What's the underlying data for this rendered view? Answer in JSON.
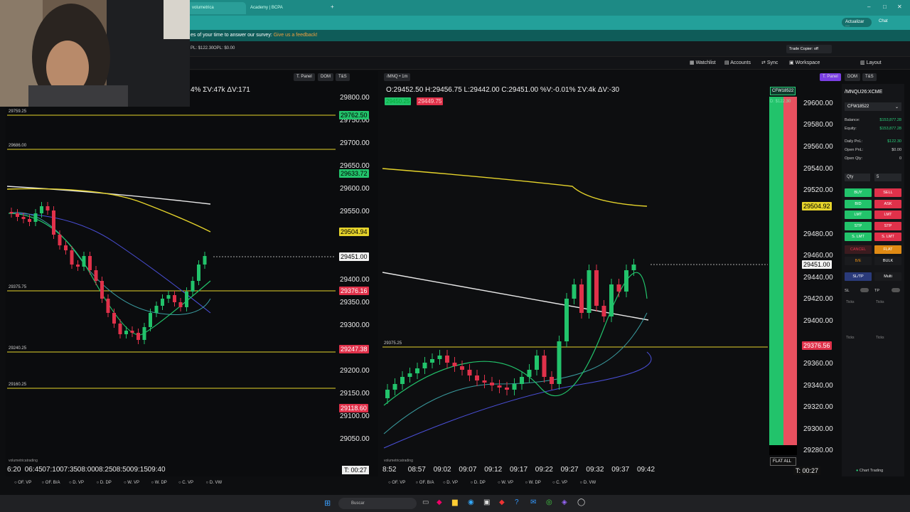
{
  "browser": {
    "tabs": [
      {
        "label": "volumetrica"
      },
      {
        "label": "Academy | BCPA"
      }
    ],
    "account_btn": "Actualizar",
    "chat_btn": "Chat"
  },
  "survey": {
    "text": "es of your time to answer our survey:",
    "link": "Give us a feedback!"
  },
  "appbar": {
    "upl": "PL: $122.30",
    "opl": "OPL: $0.00",
    "trade_copier": "Trade Copier: off"
  },
  "toolbar": {
    "watchlist": "Watchlist",
    "accounts": "Accounts",
    "sync": "Sync",
    "workspace": "Workspace",
    "layout": "Layout"
  },
  "left_chart": {
    "header_buttons": {
      "tpanel": "T. Panel",
      "dom": "DOM",
      "ts": "T&S"
    },
    "ohlc": "4% ΣV:47k ΔV:171",
    "price_axis": [
      "29800.00",
      "29750.00",
      "29700.00",
      "29650.00",
      "29600.00",
      "29550.00",
      "29450.00",
      "29400.00",
      "29350.00",
      "29300.00",
      "29200.00",
      "29150.00",
      "29100.00",
      "29050.00"
    ],
    "tags": {
      "t1": "29762.50",
      "t2": "29633.72",
      "t3": "29504.94",
      "t4": "29451.00",
      "t5": "29376.16",
      "t6": "29247.38",
      "t7": "29118.60"
    },
    "levels": [
      "29759.25",
      "29686.00",
      "29375.75",
      "29240.25",
      "29160.25"
    ],
    "time_axis": [
      "6:20",
      "06:45",
      "07:10",
      "07:35",
      "08:00",
      "08:25",
      "08:50",
      "09:15",
      "09:40"
    ],
    "timer": "T: 00:27",
    "watermark": "volumetricatrading"
  },
  "right_chart": {
    "symbol": "/MNQ",
    "timeframe": "1m",
    "header_buttons": {
      "tpanel": "T. Panel",
      "dom": "DOM",
      "ts": "T&S"
    },
    "ohlc": "O:29452.50  H:29456.75  L:29442.00  C:29451.00  %V:-0.01%  ΣV:4k  ΔV:-30",
    "bid_tag": "29450.25",
    "ask_tag": "29449.75",
    "price_axis": [
      "29600.00",
      "29580.00",
      "29560.00",
      "29540.00",
      "29520.00",
      "29480.00",
      "29460.00",
      "29440.00",
      "29420.00",
      "29400.00",
      "29360.00",
      "29340.00",
      "29320.00",
      "29300.00",
      "29280.00"
    ],
    "tags": {
      "t1": "29504.92",
      "t2": "29451.00",
      "t3": "29376.56"
    },
    "level": "29375.25",
    "time_axis": [
      "8:52",
      "08:57",
      "09:02",
      "09:07",
      "09:12",
      "09:17",
      "09:22",
      "09:27",
      "09:32",
      "09:37",
      "09:42"
    ],
    "timer": "T: 00:27",
    "account_tag": "CFW18522",
    "pnl_tag": "D: $122.30",
    "flat_all": "FLAT ALL",
    "watermark": "volumetricatrading"
  },
  "side_panel": {
    "symbol": "/MNQU26:XCME",
    "account": "CFW18522",
    "balance_label": "Balance:",
    "balance": "$153,877.28",
    "equity_label": "Equity:",
    "equity": "$153,877.28",
    "daily_pnl_label": "Daily PnL:",
    "daily_pnl": "$122.30",
    "open_pnl_label": "Open PnL:",
    "open_pnl": "$0.00",
    "open_qty_label": "Open Qty:",
    "open_qty": "0",
    "qty_label": "Qty",
    "qty_value": "5",
    "buttons": [
      [
        "BUY",
        "SELL"
      ],
      [
        "BID",
        "ASK"
      ],
      [
        "LMT",
        "LMT"
      ],
      [
        "STP",
        "STP"
      ],
      [
        "S. LMT",
        "S. LMT"
      ]
    ],
    "cancel": "CANCEL",
    "flat": "FLAT",
    "be": "B/E",
    "bulk": "BULK",
    "sltp": "SL/TP",
    "multi": "Multi",
    "sl": "SL",
    "tp": "TP",
    "ticks": "Ticks",
    "footer": "Chart Trading"
  },
  "bottom_bar": [
    "OF. VP",
    "OF. B/A",
    "D. VP",
    "D. DP",
    "W. VP",
    "W. DP",
    "C. VP",
    "D. VW"
  ],
  "taskbar": {
    "search": "Buscar"
  },
  "colors": {
    "green": "#22c36b",
    "red": "#e0314a",
    "yellow": "#e5d32b",
    "teal": "#1d8a85"
  }
}
